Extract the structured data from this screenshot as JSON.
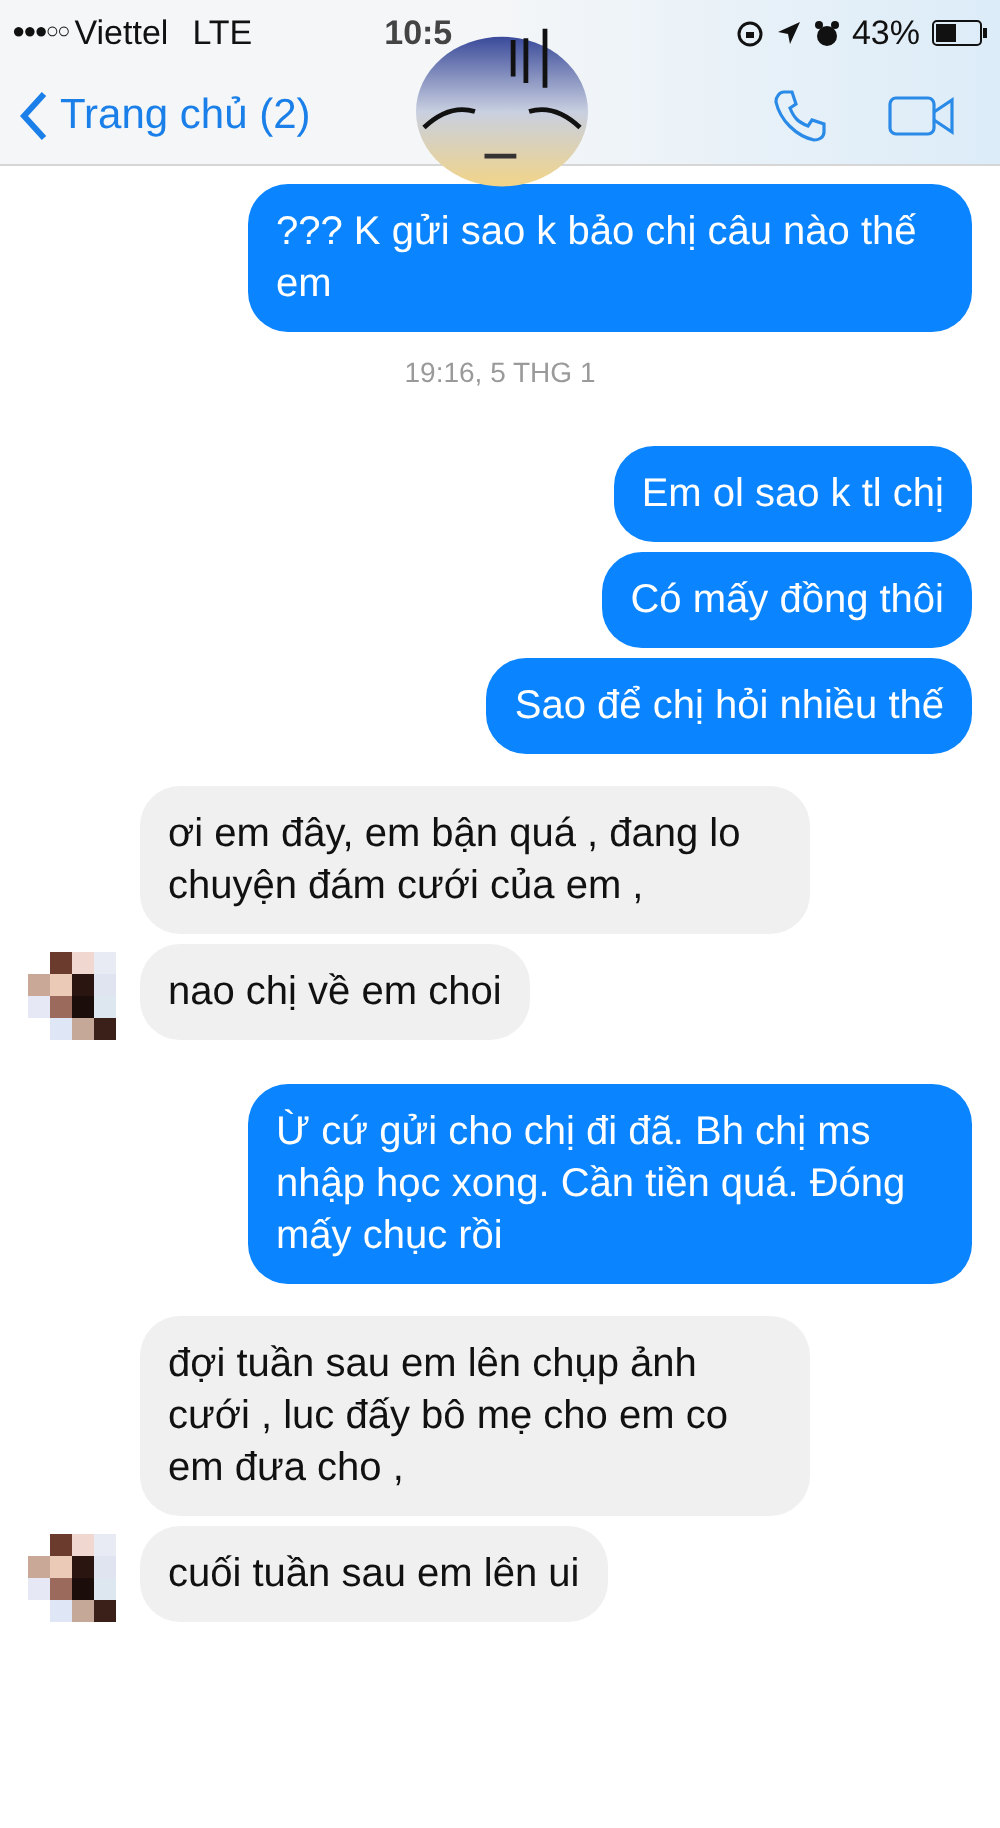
{
  "status_bar": {
    "signal": "●●●○○",
    "carrier": "Viettel",
    "network": "LTE",
    "time": "10:5",
    "battery": "43%"
  },
  "nav": {
    "back": "Trang chủ (2)"
  },
  "messages": [
    {
      "kind": "sent",
      "text": "??? K gửi sao k bảo chị câu nào thế em"
    },
    {
      "kind": "time",
      "text": "19:16, 5 THG 1"
    },
    {
      "kind": "sent",
      "text": "Em ol sao k tl chị"
    },
    {
      "kind": "sent",
      "text": "Có mấy đồng thôi"
    },
    {
      "kind": "sent",
      "text": "Sao để chị hỏi nhiều thế"
    },
    {
      "kind": "received",
      "text": "ơi em đây, em bận quá , đang lo chuyện đám cưới của em ,",
      "avatar": false
    },
    {
      "kind": "received",
      "text": "nao chị về em choi",
      "avatar": true
    },
    {
      "kind": "sent",
      "text": "Ừ cứ gửi cho chị đi đã. Bh chị ms nhập học xong. Cần tiền quá. Đóng mấy chục rồi"
    },
    {
      "kind": "received",
      "text": "đợi tuần sau em lên chụp ảnh cưới , luc đấy bô mẹ cho em co em đưa cho ,",
      "avatar": false
    },
    {
      "kind": "received",
      "text": "cuối tuần sau em lên ui",
      "avatar": true
    }
  ]
}
